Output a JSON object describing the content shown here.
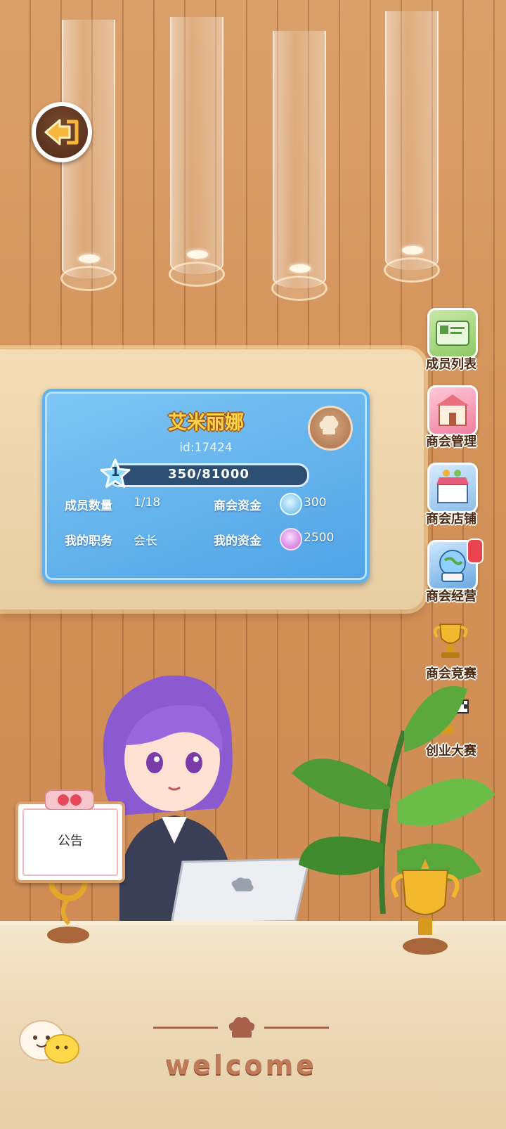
{
  "guild": {
    "name": "艾米丽娜",
    "id_label": "id:17424",
    "level": "1",
    "exp_text": "350/81000",
    "exp_current": 350,
    "exp_max": 81000
  },
  "stats": {
    "members_label": "成员数量",
    "members_value": "1/18",
    "position_label": "我的职务",
    "position_value": "会长",
    "guild_funds_label": "商会资金",
    "guild_funds_value": "300",
    "my_funds_label": "我的资金",
    "my_funds_value": "2500"
  },
  "sidebar": {
    "items": [
      {
        "label": "成员列表",
        "icon": "member-list-icon"
      },
      {
        "label": "商会管理",
        "icon": "guild-manage-icon"
      },
      {
        "label": "商会店铺",
        "icon": "guild-shop-icon"
      },
      {
        "label": "商会经营",
        "icon": "guild-operate-icon"
      },
      {
        "label": "商会竞赛",
        "icon": "guild-contest-icon"
      },
      {
        "label": "创业大赛",
        "icon": "startup-contest-icon"
      }
    ]
  },
  "notice": {
    "label": "公告"
  },
  "footer": {
    "welcome": "welcome"
  },
  "colors": {
    "card_blue": "#4fa3e6",
    "title_gold": "#ffd34a",
    "wood": "#d39258"
  }
}
